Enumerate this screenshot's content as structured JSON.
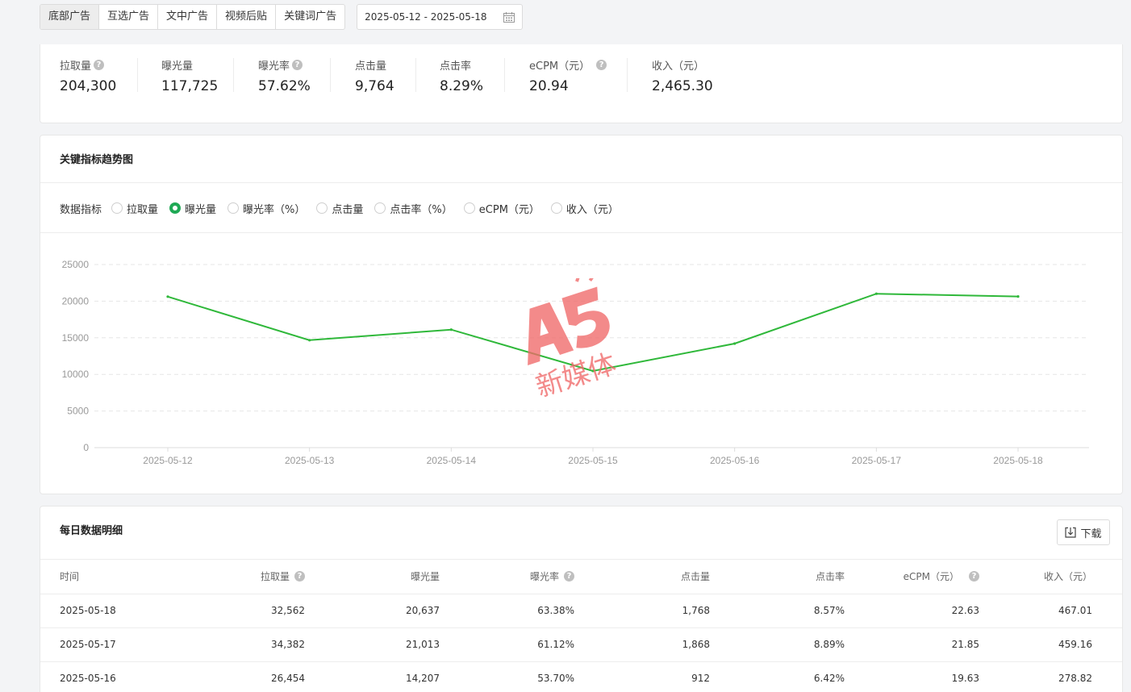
{
  "tabs": [
    {
      "label": "底部广告",
      "active": true
    },
    {
      "label": "互选广告",
      "active": false
    },
    {
      "label": "文中广告",
      "active": false
    },
    {
      "label": "视频后贴",
      "active": false
    },
    {
      "label": "关键词广告",
      "active": false
    }
  ],
  "date_range": "2025-05-12 - 2025-05-18",
  "summary": [
    {
      "label": "拉取量",
      "value": "204,300",
      "help": true
    },
    {
      "label": "曝光量",
      "value": "117,725",
      "help": false
    },
    {
      "label": "曝光率",
      "value": "57.62%",
      "help": true
    },
    {
      "label": "点击量",
      "value": "9,764",
      "help": false
    },
    {
      "label": "点击率",
      "value": "8.29%",
      "help": false
    },
    {
      "label": "eCPM（元）",
      "value": "20.94",
      "help": true
    },
    {
      "label": "收入（元）",
      "value": "2,465.30",
      "help": false
    }
  ],
  "trend": {
    "title": "关键指标趋势图",
    "metric_label": "数据指标",
    "options": [
      {
        "label": "拉取量",
        "checked": false
      },
      {
        "label": "曝光量",
        "checked": true
      },
      {
        "label": "曝光率（%）",
        "checked": false
      },
      {
        "label": "点击量",
        "checked": false
      },
      {
        "label": "点击率（%）",
        "checked": false
      },
      {
        "label": "eCPM（元）",
        "checked": false
      },
      {
        "label": "收入（元）",
        "checked": false
      }
    ]
  },
  "chart_data": {
    "type": "line",
    "title": "",
    "xlabel": "",
    "ylabel": "",
    "x": [
      "2025-05-12",
      "2025-05-13",
      "2025-05-14",
      "2025-05-15",
      "2025-05-16",
      "2025-05-17",
      "2025-05-18"
    ],
    "series": [
      {
        "values": [
          20617,
          14670,
          16110,
          10471,
          14207,
          21013,
          20637
        ]
      }
    ],
    "ylim": [
      0,
      25000
    ],
    "yticks": [
      0,
      5000,
      10000,
      15000,
      20000,
      25000
    ],
    "grid": true,
    "line_color": "#2fb83a"
  },
  "watermark": {
    "text": "新媒体"
  },
  "daily": {
    "title": "每日数据明细",
    "download_label": "下载",
    "columns": [
      {
        "label": "时间",
        "help": false
      },
      {
        "label": "拉取量",
        "help": true
      },
      {
        "label": "曝光量",
        "help": false
      },
      {
        "label": "曝光率",
        "help": true
      },
      {
        "label": "点击量",
        "help": false
      },
      {
        "label": "点击率",
        "help": false
      },
      {
        "label": "eCPM（元）",
        "help": true
      },
      {
        "label": "收入（元）",
        "help": false
      }
    ],
    "rows": [
      [
        "2025-05-18",
        "32,562",
        "20,637",
        "63.38%",
        "1,768",
        "8.57%",
        "22.63",
        "467.01"
      ],
      [
        "2025-05-17",
        "34,382",
        "21,013",
        "61.12%",
        "1,868",
        "8.89%",
        "21.85",
        "459.16"
      ],
      [
        "2025-05-16",
        "26,454",
        "14,207",
        "53.70%",
        "912",
        "6.42%",
        "19.63",
        "278.82"
      ]
    ]
  },
  "colors": {
    "accent": "#1fa955",
    "line": "#2fb83a",
    "watermark": "#f06a6a"
  }
}
